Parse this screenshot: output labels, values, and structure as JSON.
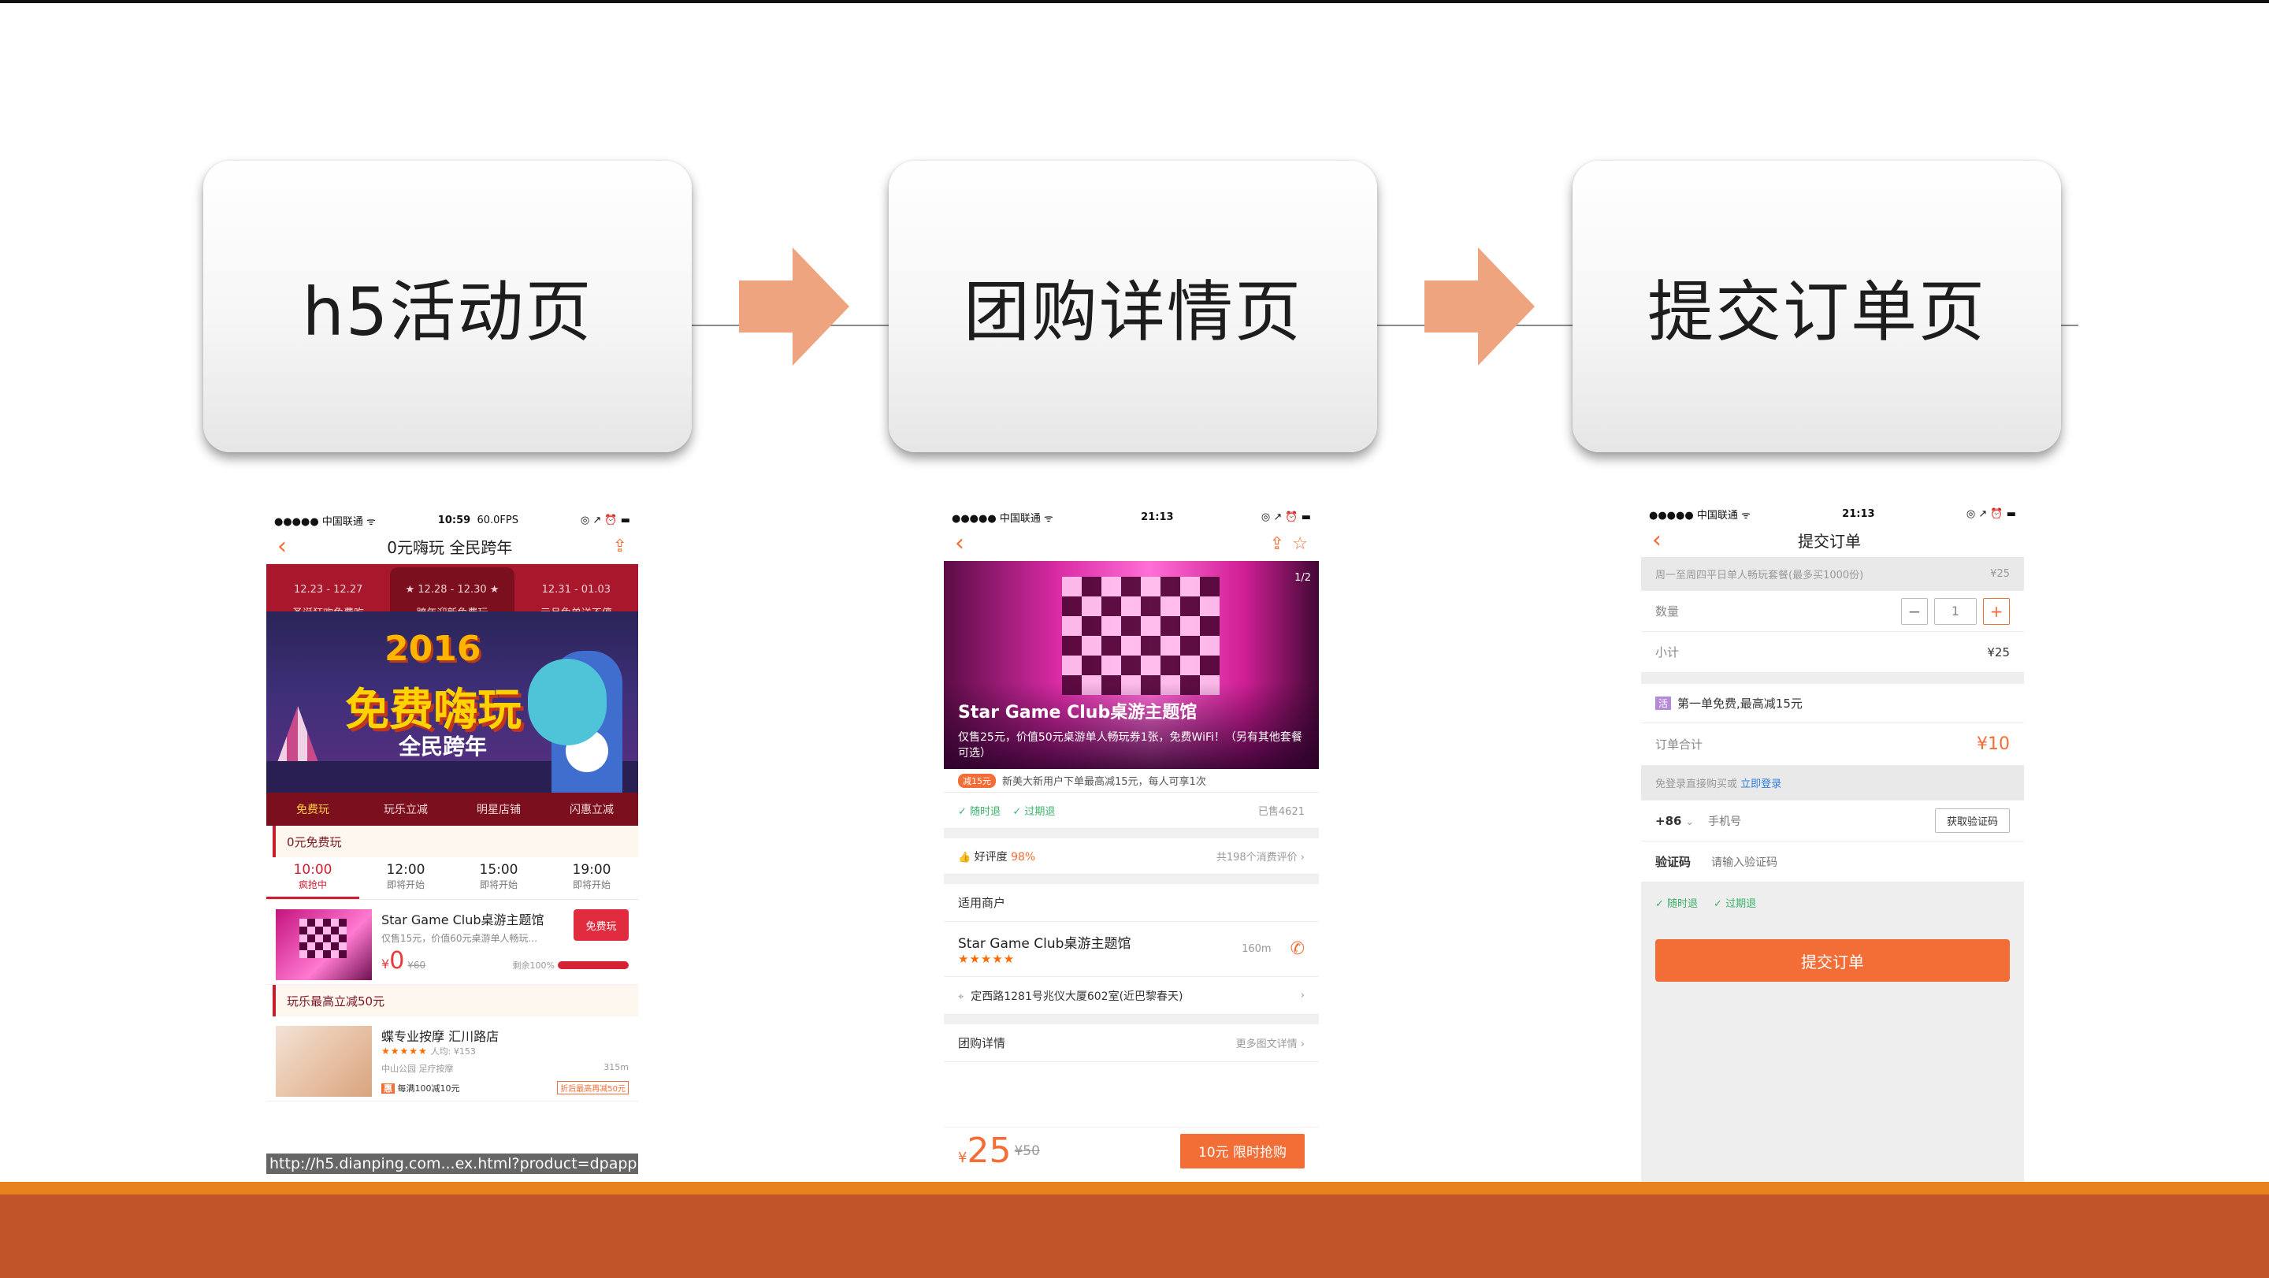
{
  "flow": {
    "step1": "h5活动页",
    "step2": "团购详情页",
    "step3": "提交订单页"
  },
  "colors": {
    "accent": "#f36d36",
    "arrow": "#eea47e",
    "band": "#c0552a",
    "band_top": "#e8821f"
  },
  "h5": {
    "status_left": "●●●●● 中国联通 ᯤ",
    "status_time": "10:59",
    "status_fps": "60.0FPS",
    "status_right": "◎ ↗ ⏰ ▬",
    "title": "0元嗨玩 全民跨年",
    "top_tabs": [
      {
        "date": "12.23 - 12.27",
        "label": "圣诞狂欢免费吃"
      },
      {
        "date": "★ 12.28 - 12.30 ★",
        "label": "跨年迎新免费玩"
      },
      {
        "date": "12.31 - 01.03",
        "label": "元旦免单送不停"
      }
    ],
    "banner_year": "2016",
    "banner_title": "免费嗨玩",
    "banner_sub": "全民跨年",
    "cats": [
      "免费玩",
      "玩乐立减",
      "明星店铺",
      "闪惠立减"
    ],
    "section1": "0元免费玩",
    "times": [
      {
        "time": "10:00",
        "state": "疯抢中"
      },
      {
        "time": "12:00",
        "state": "即将开始"
      },
      {
        "time": "15:00",
        "state": "即将开始"
      },
      {
        "time": "19:00",
        "state": "即将开始"
      }
    ],
    "deal": {
      "name": "Star Game Club桌游主题馆",
      "desc": "仅售15元，价值60元桌游单人畅玩...",
      "btn": "免费玩",
      "price_sym": "¥",
      "price": "0",
      "old": "¥60",
      "left": "剩余100%",
      "left_fraction": 1.0
    },
    "section2": "玩乐最高立减50元",
    "deal2": {
      "name": "蝶专业按摩 汇川路店",
      "stars": "★★★★★",
      "avg": "人均: ¥153",
      "area": "中山公园 足疗按摩",
      "dist": "315m",
      "promo_tag": "惠",
      "promo": "每满100减10元",
      "badge": "折后最高再减50元"
    },
    "url": "http://h5.dianping.com...ex.html?product=dpapp"
  },
  "detail": {
    "status_left": "●●●●● 中国联通 ᯤ",
    "status_time": "21:13",
    "status_right": "◎ ↗ ⏰ ▬",
    "page": "1/2",
    "title": "Star Game Club桌游主题馆",
    "desc": "仅售25元，价值50元桌游单人畅玩券1张，免费WiFi！（另有其他套餐可选）",
    "promo_tag": "减15元",
    "promo": "新美大新用户下单最高减15元，每人可享1次",
    "refund1": "随时退",
    "refund2": "过期退",
    "sold": "已售4621",
    "rating_label": "好评度",
    "rating": "98%",
    "reviews": "共198个消费评价",
    "merchant_section": "适用商户",
    "merchant": "Star Game Club桌游主题馆",
    "merchant_stars": "★★★★★",
    "distance": "160m",
    "address": "定西路1281号兆仪大厦602室(近巴黎春天)",
    "group_section": "团购详情",
    "more": "更多图文详情",
    "price_sym": "¥",
    "price": "25",
    "old": "¥50",
    "buy": "10元 限时抢购"
  },
  "order": {
    "status_left": "●●●●● 中国联通 ᯤ",
    "status_time": "21:13",
    "status_right": "◎ ↗ ⏰ ▬",
    "title": "提交订单",
    "product": "周一至周四平日单人畅玩套餐(最多买1000份)",
    "product_price": "¥25",
    "qty_label": "数量",
    "qty": "1",
    "subtotal_label": "小计",
    "subtotal": "¥25",
    "promo_tag": "活",
    "promo": "第一单免费,最高减15元",
    "total_label": "订单合计",
    "total": "¥10",
    "login_hint": "免登录直接购买或",
    "login_link": "立即登录",
    "country_code": "+86",
    "phone_placeholder": "手机号",
    "get_code": "获取验证码",
    "code_label": "验证码",
    "code_placeholder": "请输入验证码",
    "refund1": "随时退",
    "refund2": "过期退",
    "submit": "提交订单"
  }
}
